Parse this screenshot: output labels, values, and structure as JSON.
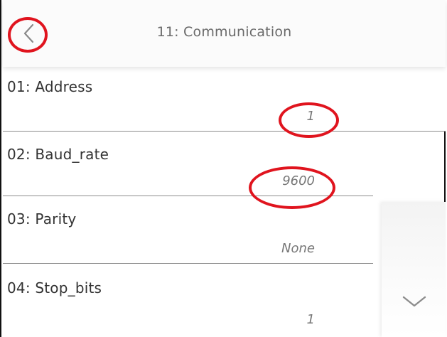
{
  "header": {
    "title": "11: Communication",
    "back_icon": "chevron-left-icon"
  },
  "rows": [
    {
      "label": "01: Address",
      "value": "1"
    },
    {
      "label": "02: Baud_rate",
      "value": "9600"
    },
    {
      "label": "03: Parity",
      "value": "None"
    },
    {
      "label": "04: Stop_bits",
      "value": "1"
    }
  ],
  "side_panel": {
    "scroll_icon": "chevron-down-icon"
  },
  "colors": {
    "highlight": "#e0141e",
    "header_bg": "#fbfbfb",
    "divider": "#8c8c8c"
  }
}
